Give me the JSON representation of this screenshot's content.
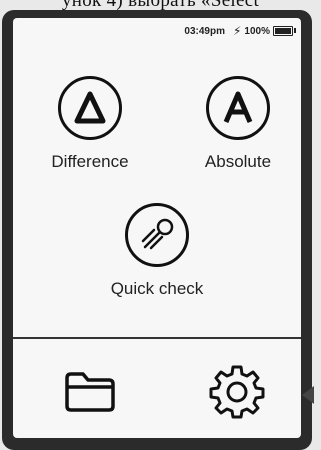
{
  "caption": "унок 4) выбрать «Select",
  "status": {
    "time": "03:49pm",
    "battery": "100%"
  },
  "modes": [
    {
      "label": "Difference",
      "symbol": "Δ",
      "icon": "delta-icon"
    },
    {
      "label": "Absolute",
      "symbol": "A",
      "icon": "absolute-a-icon"
    },
    {
      "label": "Quick check",
      "icon": "quick-check-comet-icon"
    }
  ],
  "bottom_bar": {
    "left_icon": "folder-icon",
    "right_icon": "gear-icon"
  },
  "colors": {
    "screen_bg": "#f7f7f7",
    "frame": "#2b2b2b",
    "stroke": "#111111"
  }
}
